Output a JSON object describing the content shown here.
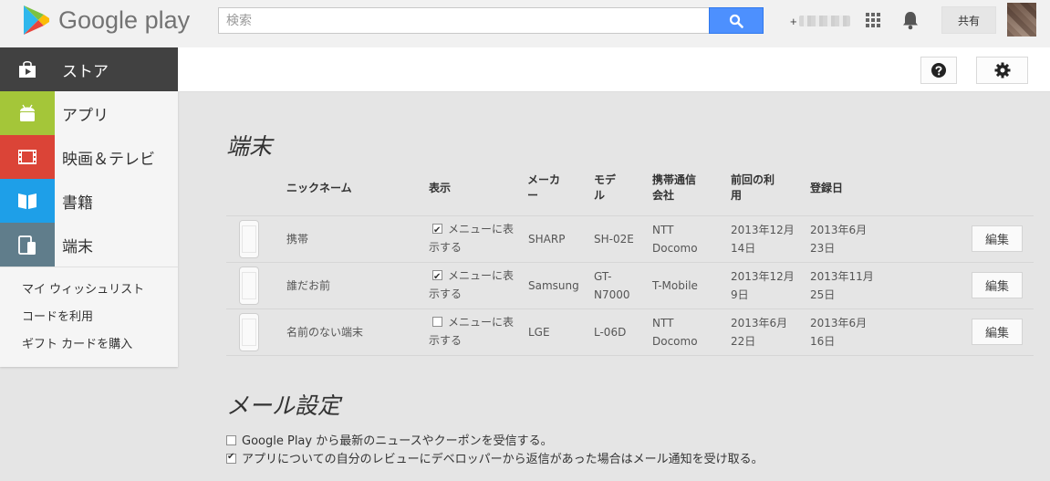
{
  "header": {
    "logo_text": "Google play",
    "search_placeholder": "検索",
    "user_handle_prefix": "+",
    "share_label": "共有",
    "icons": [
      "play-logo-icon",
      "search-icon",
      "apps-grid-icon",
      "bell-icon",
      "avatar"
    ]
  },
  "nav": {
    "items": [
      {
        "label": "ストア",
        "icon": "store-bag-icon",
        "color": "#414141",
        "active": true
      },
      {
        "label": "アプリ",
        "icon": "android-icon",
        "color": "#a4c639"
      },
      {
        "label": "映画＆テレビ",
        "icon": "film-icon",
        "color": "#db4437"
      },
      {
        "label": "書籍",
        "icon": "book-icon",
        "color": "#1e9fe8"
      },
      {
        "label": "端末",
        "icon": "device-icon",
        "color": "#607d8b"
      }
    ],
    "links": [
      "マイ ウィッシュリスト",
      "コードを利用",
      "ギフト カードを購入"
    ]
  },
  "devices": {
    "title": "端末",
    "columns": {
      "nickname": "ニックネーム",
      "display": "表示",
      "maker_line1": "メーカ",
      "maker_line2": "ー",
      "model_line1": "モデ",
      "model_line2": "ル",
      "carrier_line1": "携帯通信",
      "carrier_line2": "会社",
      "last_used_line1": "前回の利",
      "last_used_line2": "用",
      "registered": "登録日"
    },
    "rows": [
      {
        "nickname": "携帯",
        "show_in_menu": true,
        "menu_line1": "メニューに表",
        "menu_line2": "示する",
        "maker": "SHARP",
        "model_line1": "SH-02E",
        "model_line2": "",
        "carrier_line1": "NTT",
        "carrier_line2": "Docomo",
        "last_used_line1": "2013年12月",
        "last_used_line2": "14日",
        "registered_line1": "2013年6月",
        "registered_line2": "23日",
        "edit_label": "編集"
      },
      {
        "nickname": "誰だお前",
        "show_in_menu": true,
        "menu_line1": "メニューに表",
        "menu_line2": "示する",
        "maker": "Samsung",
        "model_line1": "GT-",
        "model_line2": "N7000",
        "carrier_line1": "T-Mobile",
        "carrier_line2": "",
        "last_used_line1": "2013年12月",
        "last_used_line2": "9日",
        "registered_line1": "2013年11月",
        "registered_line2": "25日",
        "edit_label": "編集"
      },
      {
        "nickname": "名前のない端末",
        "show_in_menu": false,
        "menu_line1": "メニューに表",
        "menu_line2": "示する",
        "maker": "LGE",
        "model_line1": "L-06D",
        "model_line2": "",
        "carrier_line1": "NTT",
        "carrier_line2": "Docomo",
        "last_used_line1": "2013年6月",
        "last_used_line2": "22日",
        "registered_line1": "2013年6月",
        "registered_line2": "16日",
        "edit_label": "編集"
      }
    ]
  },
  "mail_settings": {
    "title": "メール設定",
    "options": [
      {
        "label": "Google Play から最新のニュースやクーポンを受信する。",
        "checked": false
      },
      {
        "label": "アプリについての自分のレビューにデベロッパーから返信があった場合はメール通知を受け取る。",
        "checked": true
      }
    ]
  },
  "colors": {
    "search_button": "#4d90fe",
    "nav_active": "#414141",
    "page_bg": "#e5e5e5"
  }
}
